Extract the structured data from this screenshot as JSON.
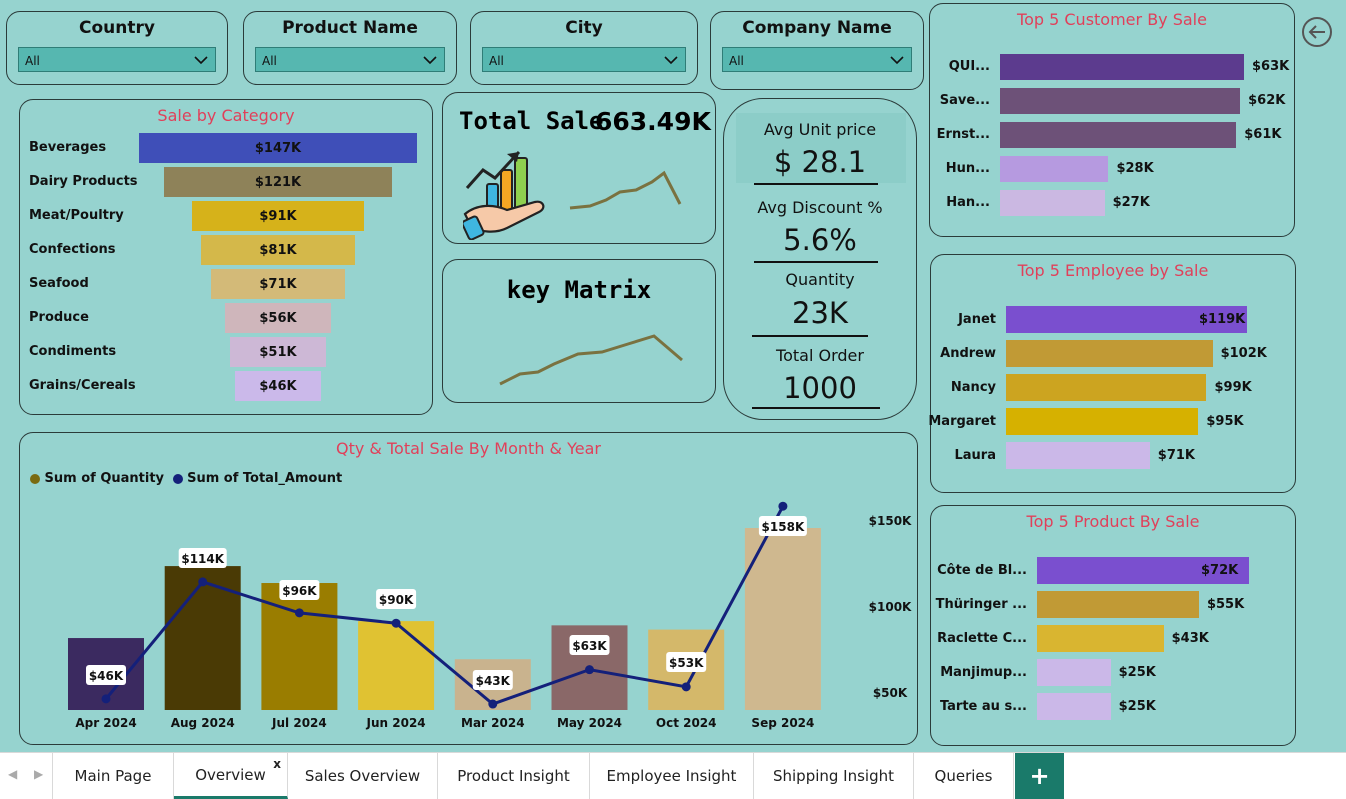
{
  "slicers": [
    {
      "title": "Country",
      "value": "All"
    },
    {
      "title": "Product Name",
      "value": "All"
    },
    {
      "title": "City",
      "value": "All"
    },
    {
      "title": "Company Name",
      "value": "All"
    }
  ],
  "kpi": {
    "total_sale_label": "Total Sale",
    "total_sale_value": "663.49K",
    "key_matrix_label": "key Matrix",
    "avg_unit_price_label": "Avg Unit price",
    "avg_unit_price_value": "$ 28.1",
    "avg_discount_label": "Avg Discount %",
    "avg_discount_value": "5.6%",
    "quantity_label": "Quantity",
    "quantity_value": "23K",
    "total_order_label": "Total Order",
    "total_order_value": "1000"
  },
  "tabs": [
    {
      "label": "Main Page"
    },
    {
      "label": "Overview",
      "active": true,
      "close": "x"
    },
    {
      "label": "Sales Overview"
    },
    {
      "label": "Product Insight"
    },
    {
      "label": "Employee Insight"
    },
    {
      "label": "Shipping Insight"
    },
    {
      "label": "Queries"
    }
  ],
  "add_tab_label": "+",
  "colors": {
    "background": "#96d3cf",
    "title_red": "#e0405a",
    "tab_add": "#1a7a6a"
  },
  "chart_data": [
    {
      "type": "bar",
      "title": "Sale by Category",
      "categories": [
        "Beverages",
        "Dairy Products",
        "Meat/Poultry",
        "Confections",
        "Seafood",
        "Produce",
        "Condiments",
        "Grains/Cereals"
      ],
      "values": [
        147,
        121,
        91,
        81,
        71,
        56,
        51,
        46
      ],
      "labels": [
        "$147K",
        "$121K",
        "$91K",
        "$81K",
        "$71K",
        "$56K",
        "$51K",
        "$46K"
      ],
      "colors": [
        "#3f4fb8",
        "#8e8259",
        "#d6b21a",
        "#d4b84a",
        "#d3ba78",
        "#cfb6bb",
        "#cdb8d6",
        "#cbb9ea"
      ],
      "unit": "K"
    },
    {
      "type": "bar",
      "title": "Top 5 Customer By Sale",
      "categories": [
        "QUI...",
        "Save...",
        "Ernst...",
        "Hun...",
        "Han..."
      ],
      "values": [
        63,
        62,
        61,
        28,
        27
      ],
      "labels": [
        "$63K",
        "$62K",
        "$61K",
        "$28K",
        "$27K"
      ],
      "colors": [
        "#5c3b8e",
        "#6d5178",
        "#6d5178",
        "#b69ae0",
        "#cbb8e2"
      ]
    },
    {
      "type": "bar",
      "title": "Top 5 Employee by Sale",
      "categories": [
        "Janet",
        "Andrew",
        "Nancy",
        "Margaret",
        "Laura"
      ],
      "values": [
        119,
        102,
        99,
        95,
        71
      ],
      "labels": [
        "$119K",
        "$102K",
        "$99K",
        "$95K",
        "$71K"
      ],
      "colors": [
        "#7a4fcf",
        "#c19a35",
        "#cca420",
        "#d6b100",
        "#cbb8e8"
      ]
    },
    {
      "type": "bar",
      "title": "Top 5 Product By Sale",
      "categories": [
        "Côte de Bl...",
        "Thüringer ...",
        "Raclette C...",
        "Manjimup...",
        "Tarte au s..."
      ],
      "values": [
        72,
        55,
        43,
        25,
        25
      ],
      "labels": [
        "$72K",
        "$55K",
        "$43K",
        "$25K",
        "$25K"
      ],
      "colors": [
        "#7a4fcf",
        "#c19a35",
        "#d9b530",
        "#cbb8e8",
        "#cbb8e8"
      ]
    },
    {
      "type": "bar",
      "title": "Qty & Total Sale By Month & Year",
      "categories": [
        "Apr 2024",
        "Aug 2024",
        "Jul 2024",
        "Jun 2024",
        "Mar 2024",
        "May 2024",
        "Oct 2024",
        "Sep 2024"
      ],
      "series": [
        {
          "name": "Sum of Quantity",
          "values": [
            1700,
            3400,
            3000,
            2100,
            1200,
            2000,
            1900,
            4300
          ],
          "colors": [
            "#3b2a60",
            "#4a3a05",
            "#9a7d00",
            "#e0c232",
            "#c9b38e",
            "#8a6868",
            "#d4b86a",
            "#cfb88f"
          ],
          "legend_color": "#7a6a10"
        },
        {
          "name": "Sum of Total_Amount",
          "values": [
            46,
            114,
            96,
            90,
            43,
            63,
            53,
            158
          ],
          "labels": [
            "$46K",
            "$114K",
            "$96K",
            "$90K",
            "$43K",
            "$63K",
            "$53K",
            "$158K"
          ],
          "color": "#14207a"
        }
      ],
      "y2_ticks": [
        "$150K",
        "$100K",
        "$50K"
      ],
      "y2_tick_values": [
        150,
        100,
        50
      ]
    }
  ]
}
